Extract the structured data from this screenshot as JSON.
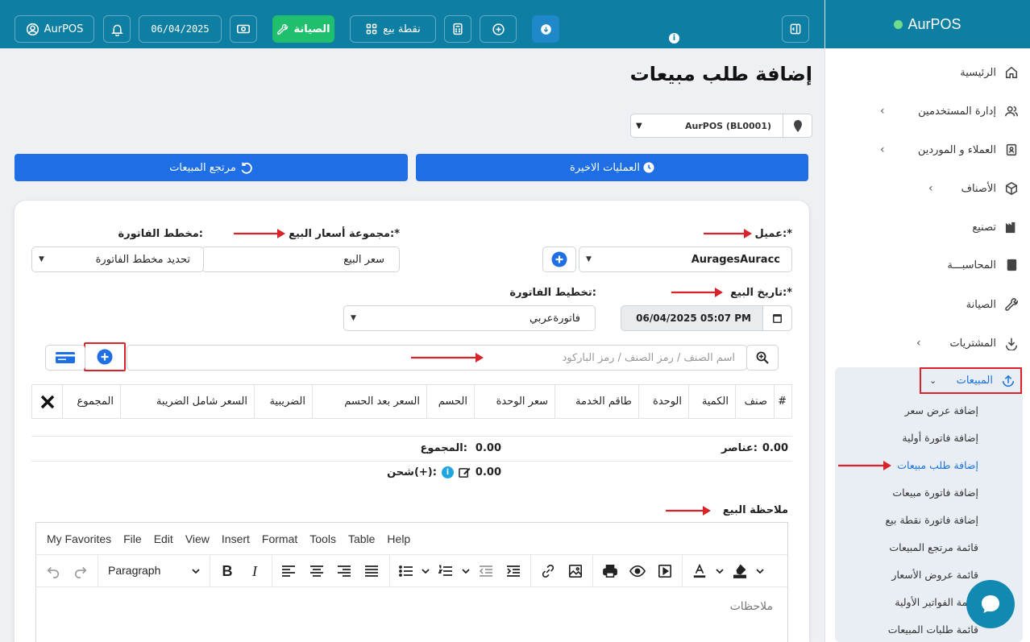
{
  "topbar": {
    "user_label": "AurPOS",
    "date": "06/04/2025",
    "maintenance_label": "الصيانة",
    "pos_label": "نقطة بيع"
  },
  "sidebar": {
    "brand": "AurPOS",
    "items": [
      {
        "label": "الرئيسية",
        "icon": "home-icon"
      },
      {
        "label": "إدارة المستخدمين",
        "icon": "users-icon"
      },
      {
        "label": "العملاء و الموردين",
        "icon": "address-book-icon"
      },
      {
        "label": "الأصناف",
        "icon": "box-icon"
      },
      {
        "label": "تصنيع",
        "icon": "factory-icon"
      },
      {
        "label": "المحاسبـــة",
        "icon": "book-icon"
      },
      {
        "label": "الصيانة",
        "icon": "wrench-icon"
      },
      {
        "label": "المشتريات",
        "icon": "download-icon"
      },
      {
        "label": "المبيعات",
        "icon": "upload-icon"
      }
    ],
    "sales_sub": [
      "إضافة عرض سعر",
      "إضافة فاتورة أولية",
      "إضافة طلب مبيعات",
      "إضافة فاتورة مبيعات",
      "إضافة فاتورة نقطة بيع",
      "قائمة مرتجع المبيعات",
      "قائمة عروض الأسعار",
      "قائمة الفواتير الأولية",
      "قائمة طلبات المبيعات"
    ]
  },
  "main": {
    "title": "إضافة طلب مبيعات",
    "branch": "AurPOS (BL0001)",
    "recent_ops_button": "العمليات الاخيرة",
    "sales_return_button": "مرتجع المبيعات"
  },
  "form": {
    "customer_label": "عميل:*",
    "customer_value": "AuragesAuracc",
    "price_group_label": "مجموعة أسعار البيع:*",
    "price_group_value": "سعر البيع",
    "invoice_scheme_label": "مخطط الفاتورة:",
    "invoice_scheme_value": "تحديد مخطط الفاتورة",
    "sale_date_label": "تاريخ البيع:*",
    "sale_date_value": "06/04/2025 05:07 PM",
    "invoice_layout_label": "تخطيط الفاتورة:",
    "invoice_layout_value": "فاتورةعربي",
    "search_placeholder": "اسم الصنف / رمز الصنف / رمز الباركود"
  },
  "table": {
    "headers": [
      "#",
      "صنف",
      "الكمية",
      "الوحدة",
      "طاقم الخدمة",
      "سعر الوحدة",
      "الحسم",
      "السعر بعد الحسم",
      "الضريبية",
      "السعر شامل الضريبة",
      "المجموع"
    ]
  },
  "totals": {
    "items_label": "عناصر:",
    "items_value": "0.00",
    "total_label": "المجموع:",
    "total_value": "0.00",
    "shipping_label": "شحن(+):",
    "shipping_value": "0.00"
  },
  "note": {
    "label": "ملاحظة البيع",
    "menu": [
      "My Favorites",
      "File",
      "Edit",
      "View",
      "Insert",
      "Format",
      "Tools",
      "Table",
      "Help"
    ],
    "paragraph": "Paragraph",
    "placeholder": "ملاحظات"
  },
  "colors": {
    "topbar": "#0f7ea3",
    "primary_button": "#1e6ee6",
    "maintenance": "#1fbf6e",
    "highlight": "#d9232b"
  }
}
